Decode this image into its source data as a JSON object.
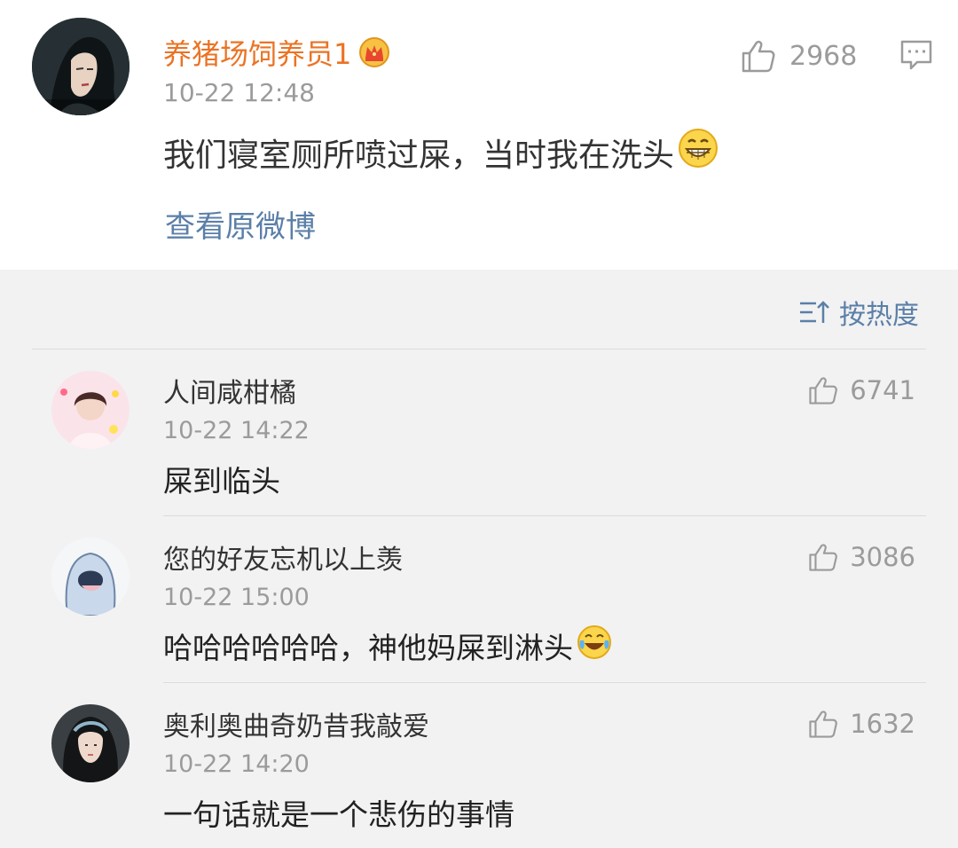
{
  "main_post": {
    "username": "养猪场饲养员1",
    "timestamp": "10-22 12:48",
    "text": "我们寝室厕所喷过屎，当时我在洗头",
    "emoji": "grin-emoji",
    "view_original": "查看原微博",
    "likes": "2968",
    "badge": "crown-icon"
  },
  "sort": {
    "label": "按热度"
  },
  "comments": [
    {
      "username": "人间咸柑橘",
      "timestamp": "10-22 14:22",
      "text": "屎到临头",
      "likes": "6741"
    },
    {
      "username": "您的好友忘机以上羡",
      "timestamp": "10-22 15:00",
      "text": "哈哈哈哈哈哈，神他妈屎到淋头",
      "likes": "3086",
      "emoji": "laugh-cry-emoji"
    },
    {
      "username": "奥利奥曲奇奶昔我敲爱",
      "timestamp": "10-22 14:20",
      "text": "一句话就是一个悲伤的事情",
      "likes": "1632"
    }
  ],
  "colors": {
    "username_vip": "#eb7324",
    "link": "#5b7fa8",
    "meta": "#9b9b9b",
    "background": "#f2f2f2"
  }
}
